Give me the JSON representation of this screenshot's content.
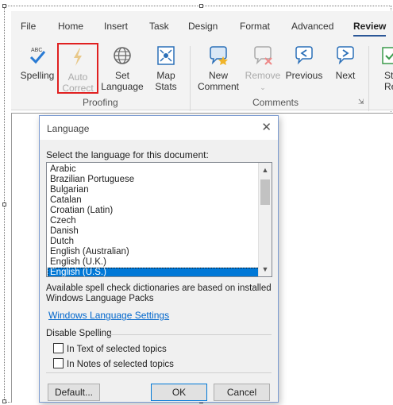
{
  "ribbon": {
    "tabs": [
      "File",
      "Home",
      "Insert",
      "Task",
      "Design",
      "Format",
      "Advanced",
      "Review"
    ],
    "active_tab": "Review",
    "groups": {
      "proofing": {
        "label": "Proofing",
        "buttons": {
          "spelling": "Spelling",
          "auto_correct_l1": "Auto",
          "auto_correct_l2": "Correct",
          "set_language_l1": "Set",
          "set_language_l2": "Language",
          "map_stats_l1": "Map",
          "map_stats_l2": "Stats"
        }
      },
      "comments": {
        "label": "Comments",
        "buttons": {
          "new_comment_l1": "New",
          "new_comment_l2": "Comment",
          "remove": "Remove",
          "previous": "Previous",
          "next": "Next"
        }
      },
      "partial": {
        "line1": "Sta",
        "line2": "Rev"
      }
    }
  },
  "dialog": {
    "title": "Language",
    "close_glyph": "✕",
    "prompt": "Select the language for this document:",
    "languages": [
      "Arabic",
      "Brazilian Portuguese",
      "Bulgarian",
      "Catalan",
      "Croatian (Latin)",
      "Czech",
      "Danish",
      "Dutch",
      "English (Australian)",
      "English (U.K.)",
      "English (U.S.)"
    ],
    "selected_language": "English (U.S.)",
    "info_line1": "Available spell check dictionaries are based on installed",
    "info_line2": "Windows Language Packs",
    "link": "Windows Language Settings",
    "disable_spelling": "Disable Spelling",
    "check_text": "In Text of selected topics",
    "check_notes": "In Notes of selected topics",
    "btn_default": "Default...",
    "btn_ok": "OK",
    "btn_cancel": "Cancel"
  },
  "colors": {
    "accent": "#0078d7",
    "highlight_box": "#e02020",
    "link": "#0066cc"
  },
  "icons": [
    "spelling-icon",
    "auto-correct-icon",
    "globe-icon",
    "map-stats-icon",
    "new-comment-icon",
    "remove-comment-icon",
    "previous-comment-icon",
    "next-comment-icon"
  ]
}
